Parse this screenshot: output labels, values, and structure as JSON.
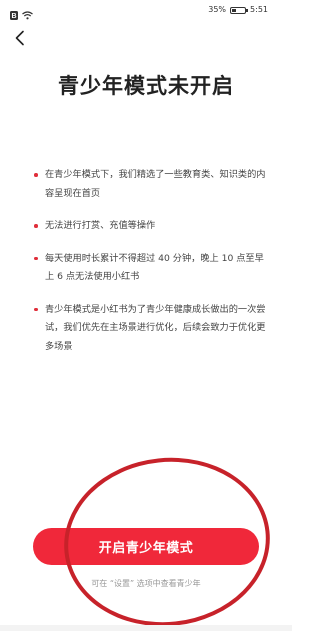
{
  "status_bar": {
    "battery_text": "35%",
    "battery_level": 0.35,
    "time": "5:51",
    "icons": [
      "b-app-icon",
      "wifi-icon",
      "battery-icon"
    ]
  },
  "header": {
    "back_icon": "back-arrow-icon"
  },
  "title": "青少年模式未开启",
  "bullets": [
    {
      "text": "在青少年模式下，我们精选了一些教育类、知识类的内容呈现在首页"
    },
    {
      "text": "无法进行打赏、充值等操作"
    },
    {
      "text": "每天使用时长累计不得超过 40 分钟，晚上 10 点至早上 6 点无法使用小红书"
    },
    {
      "text": "青少年模式是小红书为了青少年健康成长做出的一次尝试，我们优先在主场景进行优化，后续会致力于优化更多场景"
    }
  ],
  "button": {
    "label": "开启青少年模式"
  },
  "footer": {
    "note": "可在 “设置” 选项中查看青少年"
  },
  "colors": {
    "accent": "#f0283a",
    "annotation_circle": "#c7222a",
    "bullet_dot": "#e02e3a"
  }
}
